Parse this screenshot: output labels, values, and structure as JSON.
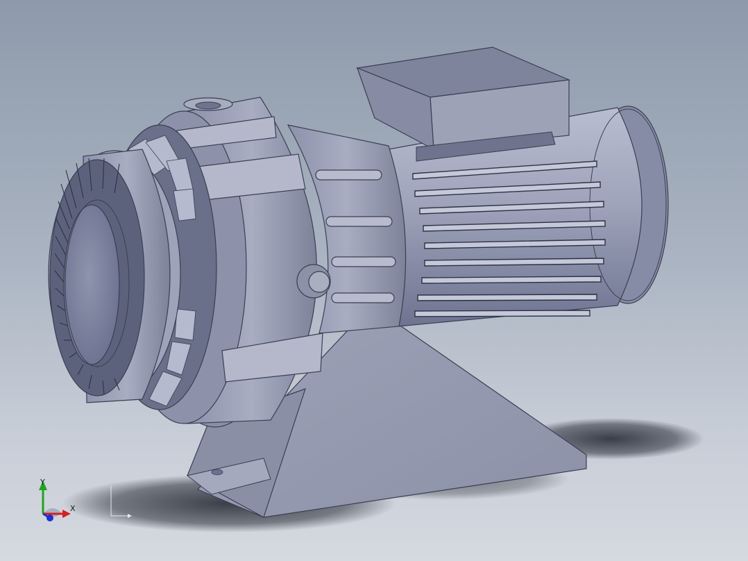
{
  "viewport": {
    "background_top": "#8e9aab",
    "background_bottom": "#d5d9e0",
    "model_color": "#9ca1b8"
  },
  "triad": {
    "x_label": "X",
    "y_label": "Y",
    "x_color": "#d42020",
    "y_color": "#1fa41f",
    "z_color": "#2030d0"
  }
}
